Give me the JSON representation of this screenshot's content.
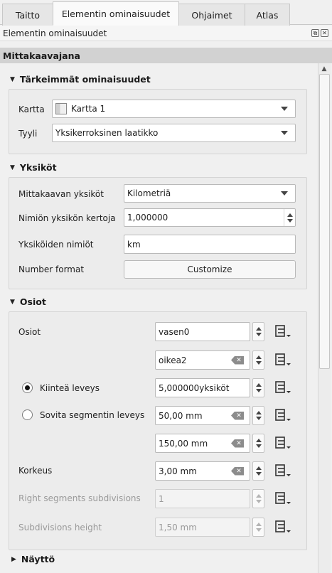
{
  "tabs": [
    {
      "label": "Taitto",
      "active": false
    },
    {
      "label": "Elementin ominaisuudet",
      "active": true
    },
    {
      "label": "Ohjaimet",
      "active": false
    },
    {
      "label": "Atlas",
      "active": false
    }
  ],
  "panel": {
    "title": "Elementin ominaisuudet",
    "float_icon": "⧉",
    "close_icon": "✕"
  },
  "item_type": "Mittakaavajana",
  "scroll": {
    "up_icon": "▲"
  },
  "groups": {
    "main": {
      "title": "Tärkeimmät ominaisuudet",
      "expand_icon": "▼",
      "map_label": "Kartta",
      "map_value": "Kartta 1",
      "style_label": "Tyyli",
      "style_value": "Yksikerroksinen laatikko"
    },
    "units": {
      "title": "Yksiköt",
      "expand_icon": "▼",
      "scale_units_label": "Mittakaavan yksiköt",
      "scale_units_value": "Kilometriä",
      "multiplier_label": "Nimiön yksikön kertoja",
      "multiplier_value": "1,000000",
      "label_units_label": "Yksiköiden nimiöt",
      "label_units_value": "km",
      "number_format_label": "Number format",
      "customize_label": "Customize"
    },
    "segments": {
      "title": "Osiot",
      "expand_icon": "▼",
      "segments_label": "Osiot",
      "left_value": "vasen0",
      "right_value": "oikea2",
      "fixed_width_label": "Kiinteä leveys",
      "fixed_width_value": "5,000000yksiköt",
      "fit_width_label": "Sovita segmentin leveys",
      "fit_min_value": "50,00 mm",
      "fit_max_value": "150,00 mm",
      "height_label": "Korkeus",
      "height_value": "3,00 mm",
      "right_subdiv_label": "Right segments subdivisions",
      "right_subdiv_value": "1",
      "subdiv_height_label": "Subdivisions height",
      "subdiv_height_value": "1,50 mm",
      "clear_icon": "✕",
      "mode": "fixed_width"
    },
    "display": {
      "title": "Näyttö",
      "expand_icon": "▶"
    }
  }
}
